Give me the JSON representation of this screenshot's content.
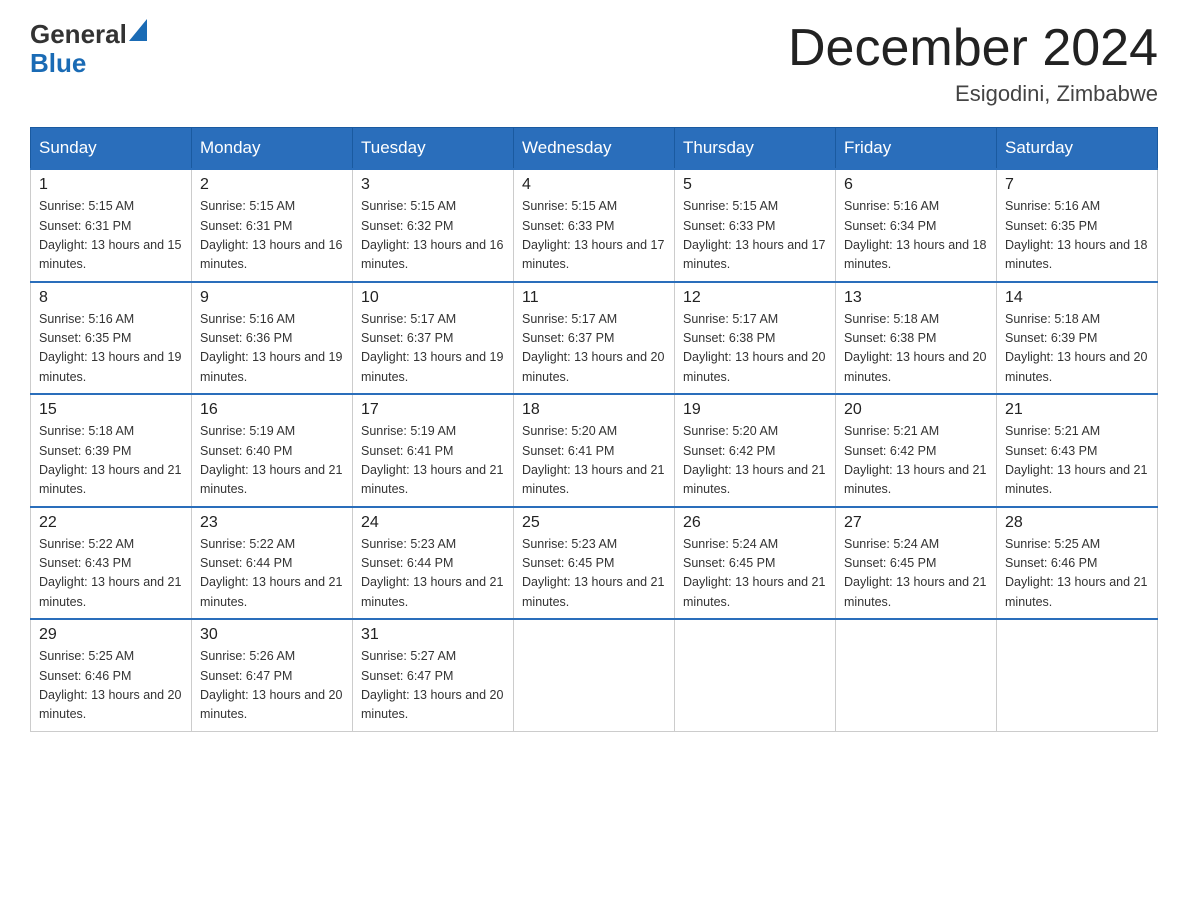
{
  "header": {
    "logo_general": "General",
    "logo_blue": "Blue",
    "month_title": "December 2024",
    "location": "Esigodini, Zimbabwe"
  },
  "days_of_week": [
    "Sunday",
    "Monday",
    "Tuesday",
    "Wednesday",
    "Thursday",
    "Friday",
    "Saturday"
  ],
  "weeks": [
    [
      {
        "day": "1",
        "sunrise": "5:15 AM",
        "sunset": "6:31 PM",
        "daylight": "13 hours and 15 minutes."
      },
      {
        "day": "2",
        "sunrise": "5:15 AM",
        "sunset": "6:31 PM",
        "daylight": "13 hours and 16 minutes."
      },
      {
        "day": "3",
        "sunrise": "5:15 AM",
        "sunset": "6:32 PM",
        "daylight": "13 hours and 16 minutes."
      },
      {
        "day": "4",
        "sunrise": "5:15 AM",
        "sunset": "6:33 PM",
        "daylight": "13 hours and 17 minutes."
      },
      {
        "day": "5",
        "sunrise": "5:15 AM",
        "sunset": "6:33 PM",
        "daylight": "13 hours and 17 minutes."
      },
      {
        "day": "6",
        "sunrise": "5:16 AM",
        "sunset": "6:34 PM",
        "daylight": "13 hours and 18 minutes."
      },
      {
        "day": "7",
        "sunrise": "5:16 AM",
        "sunset": "6:35 PM",
        "daylight": "13 hours and 18 minutes."
      }
    ],
    [
      {
        "day": "8",
        "sunrise": "5:16 AM",
        "sunset": "6:35 PM",
        "daylight": "13 hours and 19 minutes."
      },
      {
        "day": "9",
        "sunrise": "5:16 AM",
        "sunset": "6:36 PM",
        "daylight": "13 hours and 19 minutes."
      },
      {
        "day": "10",
        "sunrise": "5:17 AM",
        "sunset": "6:37 PM",
        "daylight": "13 hours and 19 minutes."
      },
      {
        "day": "11",
        "sunrise": "5:17 AM",
        "sunset": "6:37 PM",
        "daylight": "13 hours and 20 minutes."
      },
      {
        "day": "12",
        "sunrise": "5:17 AM",
        "sunset": "6:38 PM",
        "daylight": "13 hours and 20 minutes."
      },
      {
        "day": "13",
        "sunrise": "5:18 AM",
        "sunset": "6:38 PM",
        "daylight": "13 hours and 20 minutes."
      },
      {
        "day": "14",
        "sunrise": "5:18 AM",
        "sunset": "6:39 PM",
        "daylight": "13 hours and 20 minutes."
      }
    ],
    [
      {
        "day": "15",
        "sunrise": "5:18 AM",
        "sunset": "6:39 PM",
        "daylight": "13 hours and 21 minutes."
      },
      {
        "day": "16",
        "sunrise": "5:19 AM",
        "sunset": "6:40 PM",
        "daylight": "13 hours and 21 minutes."
      },
      {
        "day": "17",
        "sunrise": "5:19 AM",
        "sunset": "6:41 PM",
        "daylight": "13 hours and 21 minutes."
      },
      {
        "day": "18",
        "sunrise": "5:20 AM",
        "sunset": "6:41 PM",
        "daylight": "13 hours and 21 minutes."
      },
      {
        "day": "19",
        "sunrise": "5:20 AM",
        "sunset": "6:42 PM",
        "daylight": "13 hours and 21 minutes."
      },
      {
        "day": "20",
        "sunrise": "5:21 AM",
        "sunset": "6:42 PM",
        "daylight": "13 hours and 21 minutes."
      },
      {
        "day": "21",
        "sunrise": "5:21 AM",
        "sunset": "6:43 PM",
        "daylight": "13 hours and 21 minutes."
      }
    ],
    [
      {
        "day": "22",
        "sunrise": "5:22 AM",
        "sunset": "6:43 PM",
        "daylight": "13 hours and 21 minutes."
      },
      {
        "day": "23",
        "sunrise": "5:22 AM",
        "sunset": "6:44 PM",
        "daylight": "13 hours and 21 minutes."
      },
      {
        "day": "24",
        "sunrise": "5:23 AM",
        "sunset": "6:44 PM",
        "daylight": "13 hours and 21 minutes."
      },
      {
        "day": "25",
        "sunrise": "5:23 AM",
        "sunset": "6:45 PM",
        "daylight": "13 hours and 21 minutes."
      },
      {
        "day": "26",
        "sunrise": "5:24 AM",
        "sunset": "6:45 PM",
        "daylight": "13 hours and 21 minutes."
      },
      {
        "day": "27",
        "sunrise": "5:24 AM",
        "sunset": "6:45 PM",
        "daylight": "13 hours and 21 minutes."
      },
      {
        "day": "28",
        "sunrise": "5:25 AM",
        "sunset": "6:46 PM",
        "daylight": "13 hours and 21 minutes."
      }
    ],
    [
      {
        "day": "29",
        "sunrise": "5:25 AM",
        "sunset": "6:46 PM",
        "daylight": "13 hours and 20 minutes."
      },
      {
        "day": "30",
        "sunrise": "5:26 AM",
        "sunset": "6:47 PM",
        "daylight": "13 hours and 20 minutes."
      },
      {
        "day": "31",
        "sunrise": "5:27 AM",
        "sunset": "6:47 PM",
        "daylight": "13 hours and 20 minutes."
      },
      null,
      null,
      null,
      null
    ]
  ]
}
